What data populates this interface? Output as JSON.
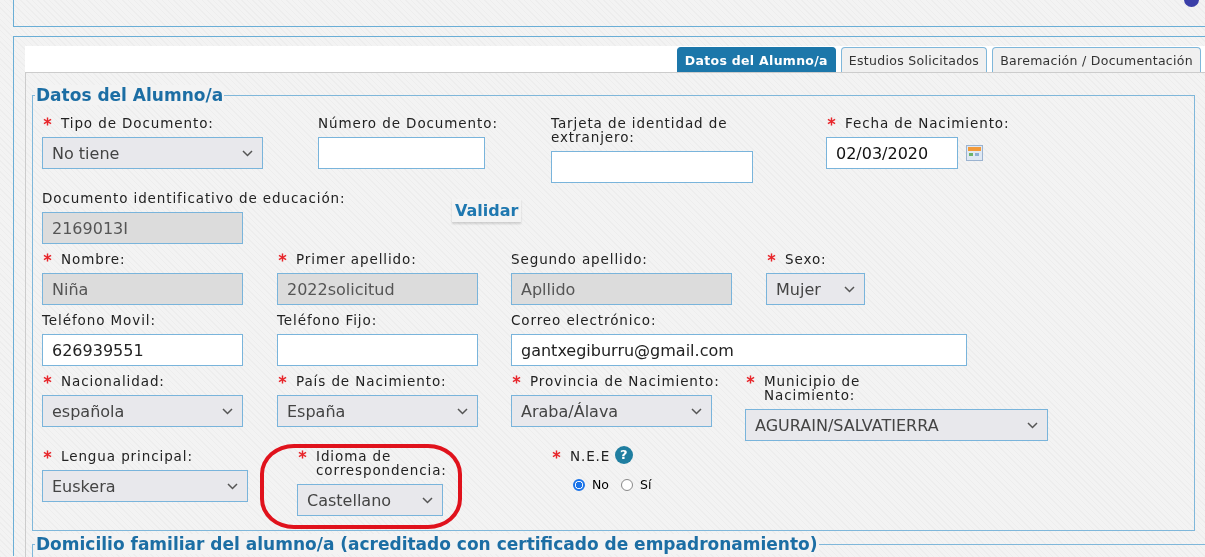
{
  "tabs": [
    {
      "label": "Datos del Alumno/a",
      "selected": true
    },
    {
      "label": "Estudios Solicitados",
      "selected": false
    },
    {
      "label": "Baremación / Documentación",
      "selected": false
    }
  ],
  "section": {
    "legend": "Datos del Alumno/a",
    "rows": [
      [
        {
          "kind": "select",
          "label": "Tipo de Documento:",
          "required": true,
          "value": "No tiene",
          "disabled": false,
          "highlighted": false
        },
        {
          "kind": "input",
          "label": "Número de Documento:",
          "required": false,
          "disabled": false,
          "highlighted": false
        },
        {
          "kind": "input",
          "label": "Tarjeta de identidad de extranjero:",
          "required": false,
          "disabled": false,
          "highlighted": false
        },
        {
          "kind": "date",
          "label": "Fecha de Nacimiento:",
          "required": true,
          "value": "02/03/2020",
          "disabled": false,
          "highlighted": false
        }
      ],
      [
        {
          "kind": "input",
          "label": "Documento identificativo de educación:",
          "required": false,
          "value": "2169013I",
          "disabled": true,
          "highlighted": false
        },
        {
          "kind": "button",
          "label": "Validar"
        }
      ],
      [
        {
          "kind": "input",
          "label": "Nombre:",
          "required": true,
          "value": "Niña",
          "disabled": true,
          "highlighted": false
        },
        {
          "kind": "input",
          "label": "Primer apellido:",
          "required": true,
          "value": "2022solicitud",
          "disabled": true,
          "highlighted": false
        },
        {
          "kind": "input",
          "label": "Segundo apellido:",
          "required": false,
          "value": "Apllido",
          "disabled": true,
          "highlighted": false
        },
        {
          "kind": "select",
          "label": "Sexo:",
          "required": true,
          "value": "Mujer",
          "disabled": false,
          "highlighted": false
        }
      ],
      [
        {
          "kind": "input",
          "label": "Teléfono Movil:",
          "required": false,
          "value": "626939551",
          "disabled": false,
          "highlighted": false
        },
        {
          "kind": "input",
          "label": "Teléfono Fijo:",
          "required": false,
          "disabled": false,
          "highlighted": false
        },
        {
          "kind": "input",
          "label": "Correo electrónico:",
          "required": false,
          "value": "gantxegiburru@gmail.com",
          "disabled": false,
          "highlighted": false
        }
      ],
      [
        {
          "kind": "select",
          "label": "Nacionalidad:",
          "required": true,
          "value": "española",
          "disabled": false,
          "highlighted": false
        },
        {
          "kind": "select",
          "label": "País de Nacimiento:",
          "required": true,
          "value": "España",
          "disabled": false,
          "highlighted": false
        },
        {
          "kind": "select",
          "label": "Provincia de Nacimiento:",
          "required": true,
          "value": "Araba/Álava",
          "disabled": false,
          "highlighted": false
        },
        {
          "kind": "select",
          "label": "Municipio de Nacimiento:",
          "required": true,
          "value": "AGURAIN/SALVATIERRA",
          "disabled": false,
          "highlighted": false
        }
      ],
      [
        {
          "kind": "select",
          "label": "Lengua principal:",
          "required": true,
          "value": "Euskera",
          "disabled": false,
          "highlighted": false
        },
        {
          "kind": "select",
          "label": "Idioma de correspondencia:",
          "required": true,
          "value": "Castellano",
          "disabled": false,
          "highlighted": true
        },
        {
          "kind": "radio",
          "label": "N.E.E",
          "required": true,
          "highlighted": false,
          "help": "?",
          "options": [
            {
              "label": "No",
              "selected": true
            },
            {
              "label": "Sí",
              "selected": false
            }
          ]
        }
      ]
    ]
  },
  "next_section": {
    "legend": "Domicilio familiar del alumno/a (acreditado con certificado de empadronamiento)"
  }
}
